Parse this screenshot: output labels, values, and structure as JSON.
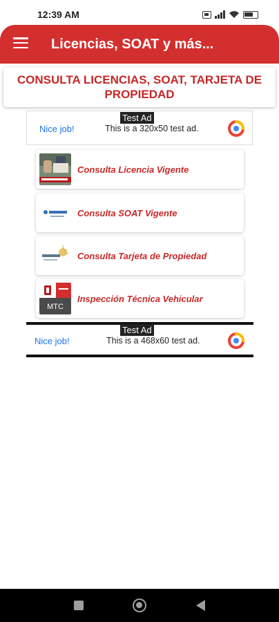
{
  "status_bar": {
    "time": "12:39 AM",
    "icons": [
      "sim-card-icon",
      "signal-icon",
      "wifi-icon",
      "battery-icon"
    ]
  },
  "app_bar": {
    "title": "Licencias, SOAT y más...",
    "menu_icon": "hamburger-menu-icon",
    "background_color": "#d32f2f"
  },
  "header": {
    "text": "CONSULTA LICENCIAS, SOAT, TARJETA DE PROPIEDAD",
    "color": "#c62828"
  },
  "ad_top": {
    "label": "Test Ad",
    "nice_job": "Nice job!",
    "text": "This is a 320x50 test ad."
  },
  "menu_items": [
    {
      "label": "Consulta Licencia Vigente",
      "icon": "license-photo-thumbnail"
    },
    {
      "label": "Consulta SOAT Vigente",
      "icon": "apeseg-logo"
    },
    {
      "label": "Consulta Tarjeta de Propiedad",
      "icon": "sunarp-logo"
    },
    {
      "label": "Inspección Técnica Vehicular",
      "icon": "mtc-peru-logo"
    }
  ],
  "ad_bottom": {
    "label": "Test Ad",
    "nice_job": "Nice job!",
    "text": "This is a 468x60 test ad."
  },
  "nav_bar": {
    "icons": [
      "recent-apps-icon",
      "home-icon",
      "back-icon"
    ]
  }
}
